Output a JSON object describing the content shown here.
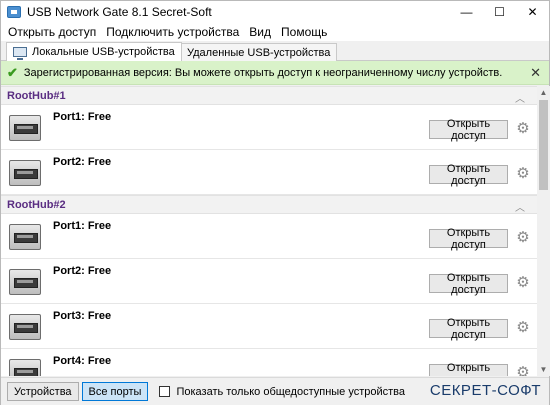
{
  "window": {
    "title": "USB Network Gate 8.1 Secret-Soft",
    "minimize": "—",
    "maximize": "☐",
    "close": "✕"
  },
  "menu": [
    "Открыть доступ",
    "Подключить устройства",
    "Вид",
    "Помощь"
  ],
  "tabs": [
    {
      "label": "Локальные USB-устройства",
      "active": true
    },
    {
      "label": "Удаленные USB-устройства",
      "active": false
    }
  ],
  "notice": {
    "text": "Зарегистрированная версия: Вы можете открыть доступ к неограниченному числу устройств.",
    "check": "✔",
    "close": "✕"
  },
  "hubs": [
    {
      "name": "RootHub#1",
      "collapse": "︿",
      "ports": [
        {
          "label": "Port1: Free",
          "button": "Открыть доступ"
        },
        {
          "label": "Port2: Free",
          "button": "Открыть доступ"
        }
      ]
    },
    {
      "name": "RootHub#2",
      "collapse": "︿",
      "ports": [
        {
          "label": "Port1: Free",
          "button": "Открыть доступ"
        },
        {
          "label": "Port2: Free",
          "button": "Открыть доступ"
        },
        {
          "label": "Port3: Free",
          "button": "Открыть доступ"
        },
        {
          "label": "Port4: Free",
          "button": "Открыть доступ"
        }
      ]
    }
  ],
  "gear_glyph": "⚙",
  "bottom": {
    "devices_button": "Устройства",
    "all_ports_button": "Все порты",
    "checkbox_label": "Показать только общедоступные устройства",
    "brand": "СЕКРЕТ-СОФТ"
  },
  "colors": {
    "notice_bg": "#d9f2c9",
    "hub_name": "#5a2d82",
    "active_button": "#cce4f7"
  }
}
